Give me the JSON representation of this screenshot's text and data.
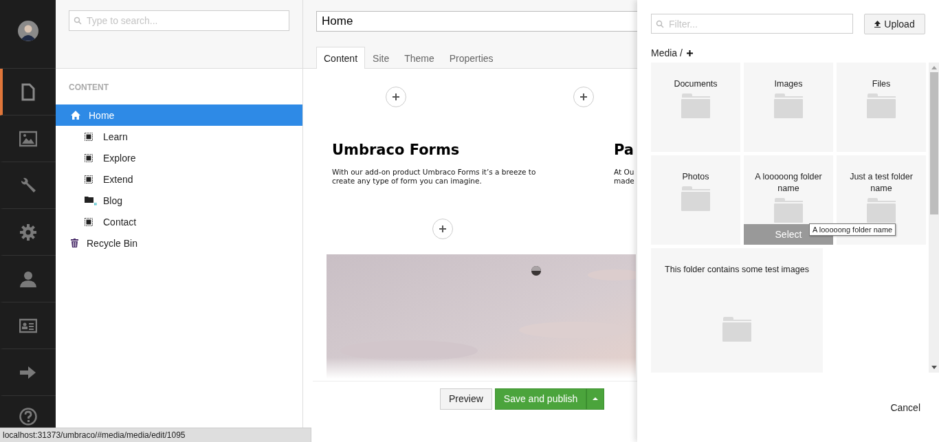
{
  "nav": {
    "items": [
      {
        "selected": true
      },
      {
        "selected": false
      },
      {
        "selected": false
      },
      {
        "selected": false
      },
      {
        "selected": false
      },
      {
        "selected": false
      },
      {
        "selected": false
      }
    ]
  },
  "tree": {
    "search": {
      "placeholder": "Type to search..."
    },
    "section_title": "CONTENT",
    "items": [
      {
        "label": "Home",
        "kind": "home",
        "selected": true,
        "children": [
          {
            "label": "Learn",
            "kind": "page",
            "selected": false
          },
          {
            "label": "Explore",
            "kind": "page",
            "selected": false
          },
          {
            "label": "Extend",
            "kind": "page",
            "selected": false
          },
          {
            "label": "Blog",
            "kind": "folder",
            "selected": false
          },
          {
            "label": "Contact",
            "kind": "page",
            "selected": false
          }
        ]
      },
      {
        "label": "Recycle Bin",
        "kind": "bin",
        "selected": false
      }
    ]
  },
  "editor": {
    "name": {
      "value": "Home"
    },
    "tabs": [
      {
        "label": "Content",
        "selected": true
      },
      {
        "label": "Site",
        "selected": false
      },
      {
        "label": "Theme",
        "selected": false
      },
      {
        "label": "Properties",
        "selected": false
      }
    ],
    "blocks": [
      {
        "title": "Umbraco Forms",
        "lines": [
          "With our add-on product Umbraco Forms it’s a breeze to create any type of form you can imagine."
        ]
      },
      {
        "title": "Pa",
        "lines": [
          "At Ou",
          "made"
        ]
      }
    ],
    "buttons": {
      "preview": "Preview",
      "save": "Save and publish"
    }
  },
  "media_picker": {
    "filter": {
      "placeholder": "Filter..."
    },
    "upload": "Upload",
    "breadcrumb": "Media /",
    "folders": [
      {
        "name": "Documents",
        "kind": "tile",
        "hovered": false
      },
      {
        "name": "Images",
        "kind": "tile",
        "hovered": false
      },
      {
        "name": "Files",
        "kind": "tile",
        "hovered": false
      },
      {
        "name": "Photos",
        "kind": "tile",
        "hovered": false
      },
      {
        "name": "A looooong folder name",
        "kind": "tile",
        "hovered": true
      },
      {
        "name": "Just a test folder name",
        "kind": "tile",
        "hovered": false
      },
      {
        "name": "This folder contains some test images",
        "kind": "large",
        "hovered": false
      }
    ],
    "select_label": "Select",
    "tooltip": "A looooong folder name",
    "cancel": "Cancel"
  },
  "status_bar": {
    "url": "localhost:31373/umbraco/#media/media/edit/1095"
  }
}
